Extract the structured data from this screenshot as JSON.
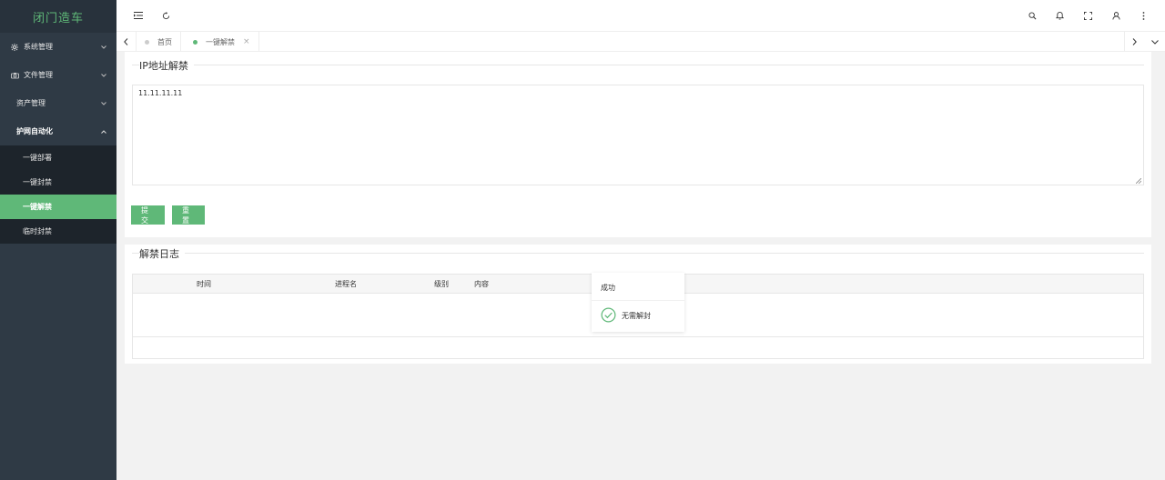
{
  "app": {
    "title": "闭门造车"
  },
  "sidebar": {
    "items": [
      {
        "label": "系统管理",
        "icon": "gear-icon"
      },
      {
        "label": "文件管理",
        "icon": "camera-icon"
      },
      {
        "label": "资产管理"
      },
      {
        "label": "护网自动化"
      }
    ],
    "submenu": [
      {
        "label": "一键部署"
      },
      {
        "label": "一键封禁"
      },
      {
        "label": "一键解禁"
      },
      {
        "label": "临时封禁"
      }
    ]
  },
  "tabs": [
    {
      "label": "首页"
    },
    {
      "label": "一键解禁"
    }
  ],
  "form": {
    "legend": "IP地址解禁",
    "textarea_value": "11.11.11.11",
    "submit_label": "提交",
    "reset_label": "重置"
  },
  "log": {
    "legend": "解禁日志",
    "columns": [
      "时间",
      "进程名",
      "级别",
      "内容"
    ]
  },
  "popup": {
    "title": "成功",
    "message": "无需解封"
  },
  "colors": {
    "accent": "#5fb878",
    "sidebar": "#2f3a45",
    "submenu": "#1d242b"
  }
}
